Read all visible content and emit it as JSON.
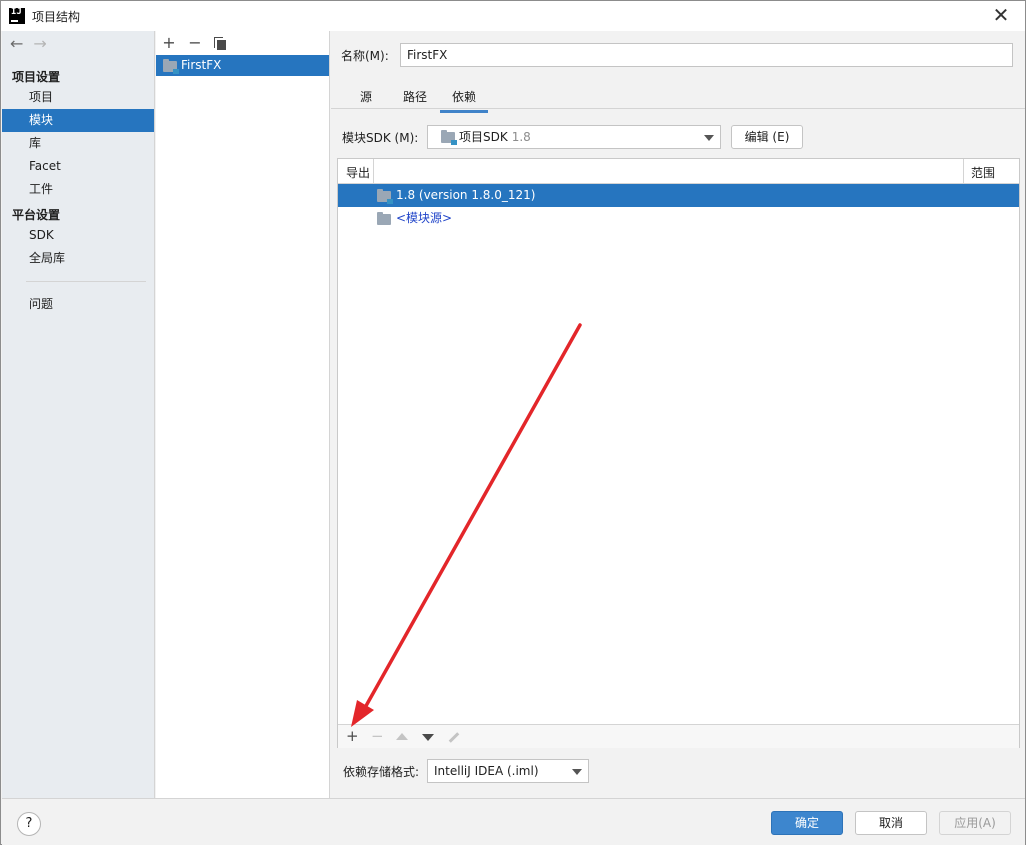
{
  "window": {
    "title": "项目结构",
    "app_icon_text": "IJ",
    "close_glyph": "✕"
  },
  "nav": {
    "back_glyph": "←",
    "forward_glyph": "→",
    "group_project": "项目设置",
    "group_platform": "平台设置",
    "items": [
      {
        "label": "项目"
      },
      {
        "label": "模块"
      },
      {
        "label": "库"
      },
      {
        "label": "Facet"
      },
      {
        "label": "工件"
      },
      {
        "label": "SDK"
      },
      {
        "label": "全局库"
      },
      {
        "label": "问题"
      }
    ],
    "selected": "模块"
  },
  "modules": {
    "toolbar": {
      "add": "+",
      "remove": "−"
    },
    "items": [
      {
        "label": "FirstFX"
      }
    ]
  },
  "module_settings": {
    "name_label": "名称(M):",
    "name_value": "FirstFX",
    "tabs": [
      {
        "label": "源"
      },
      {
        "label": "路径"
      },
      {
        "label": "依赖"
      }
    ],
    "active_tab": "依赖",
    "sdk_label": "模块SDK (M):",
    "sdk_value": "项目SDK",
    "sdk_version": "1.8",
    "edit_button": "编辑 (E)",
    "table": {
      "col_export": "导出",
      "col_scope": "范围",
      "rows": [
        {
          "label": "1.8 (version 1.8.0_121)"
        },
        {
          "label": "<模块源>"
        }
      ]
    },
    "table_toolbar": {
      "add": "+",
      "remove": "−"
    },
    "storage_label": "依赖存储格式:",
    "storage_value": "IntelliJ IDEA (.iml)"
  },
  "footer": {
    "help": "?",
    "ok": "确定",
    "cancel": "取消",
    "apply": "应用(A)"
  },
  "colors": {
    "selection": "#2675bf",
    "accent_button": "#3d86ce",
    "annotation_arrow": "#e3262a"
  }
}
